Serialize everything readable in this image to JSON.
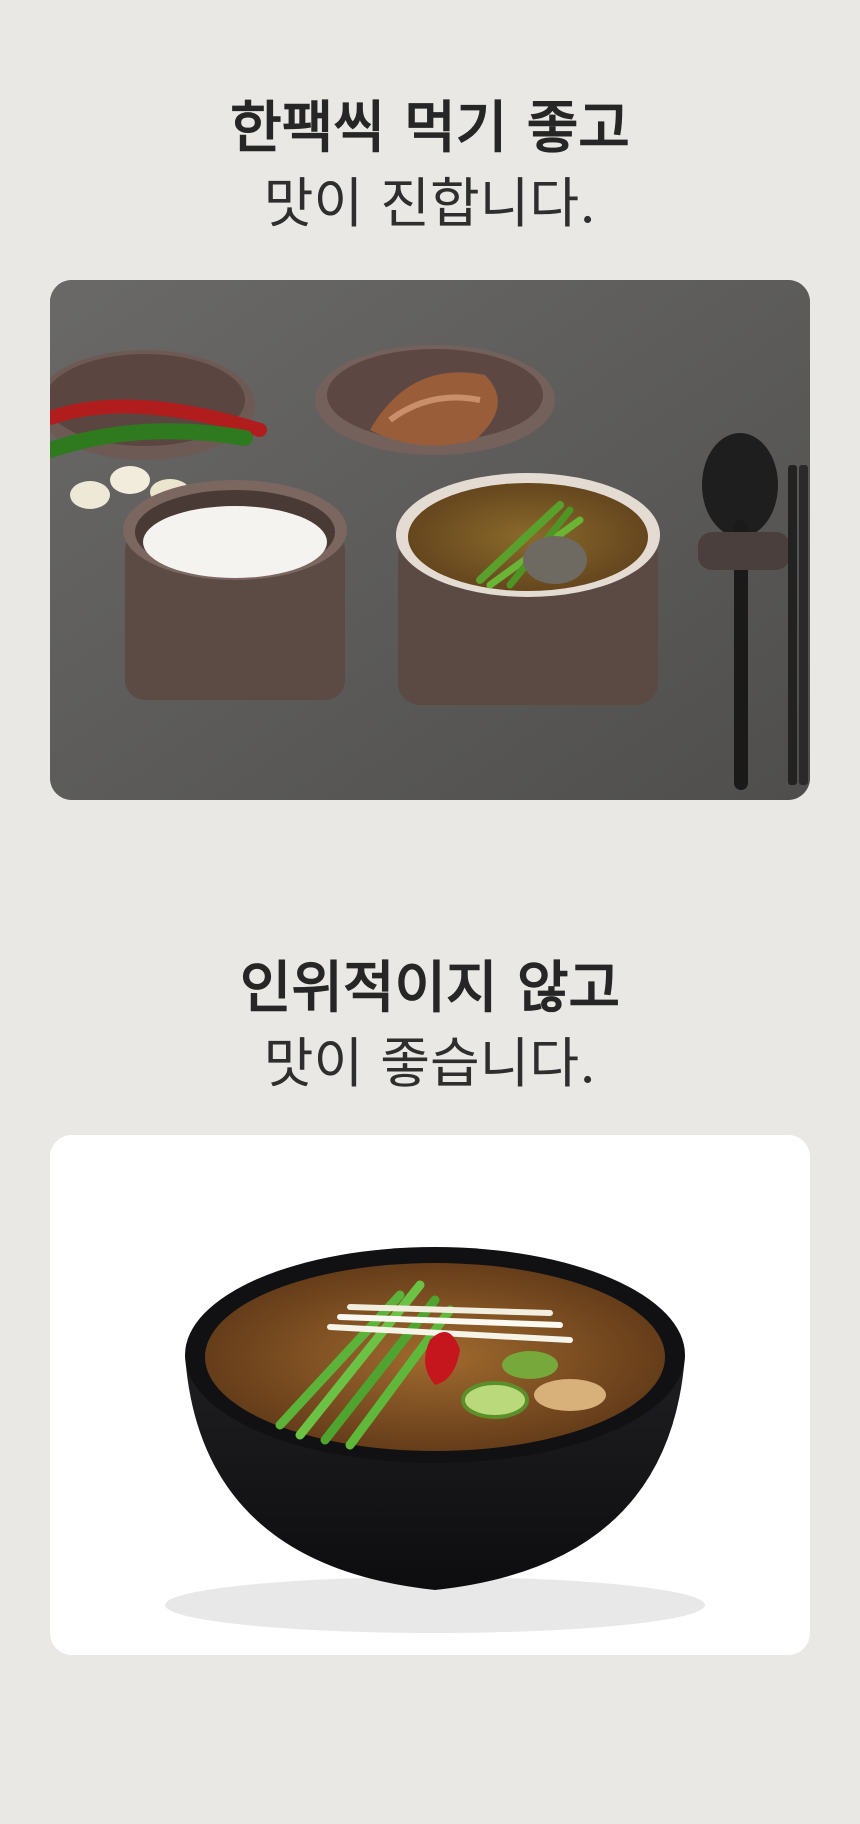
{
  "section1": {
    "title_bold": "한팩씩 먹기 좋고",
    "title_light": "맛이 진합니다."
  },
  "section2": {
    "title_bold": "인위적이지 않고",
    "title_light": "맛이 좋습니다."
  }
}
